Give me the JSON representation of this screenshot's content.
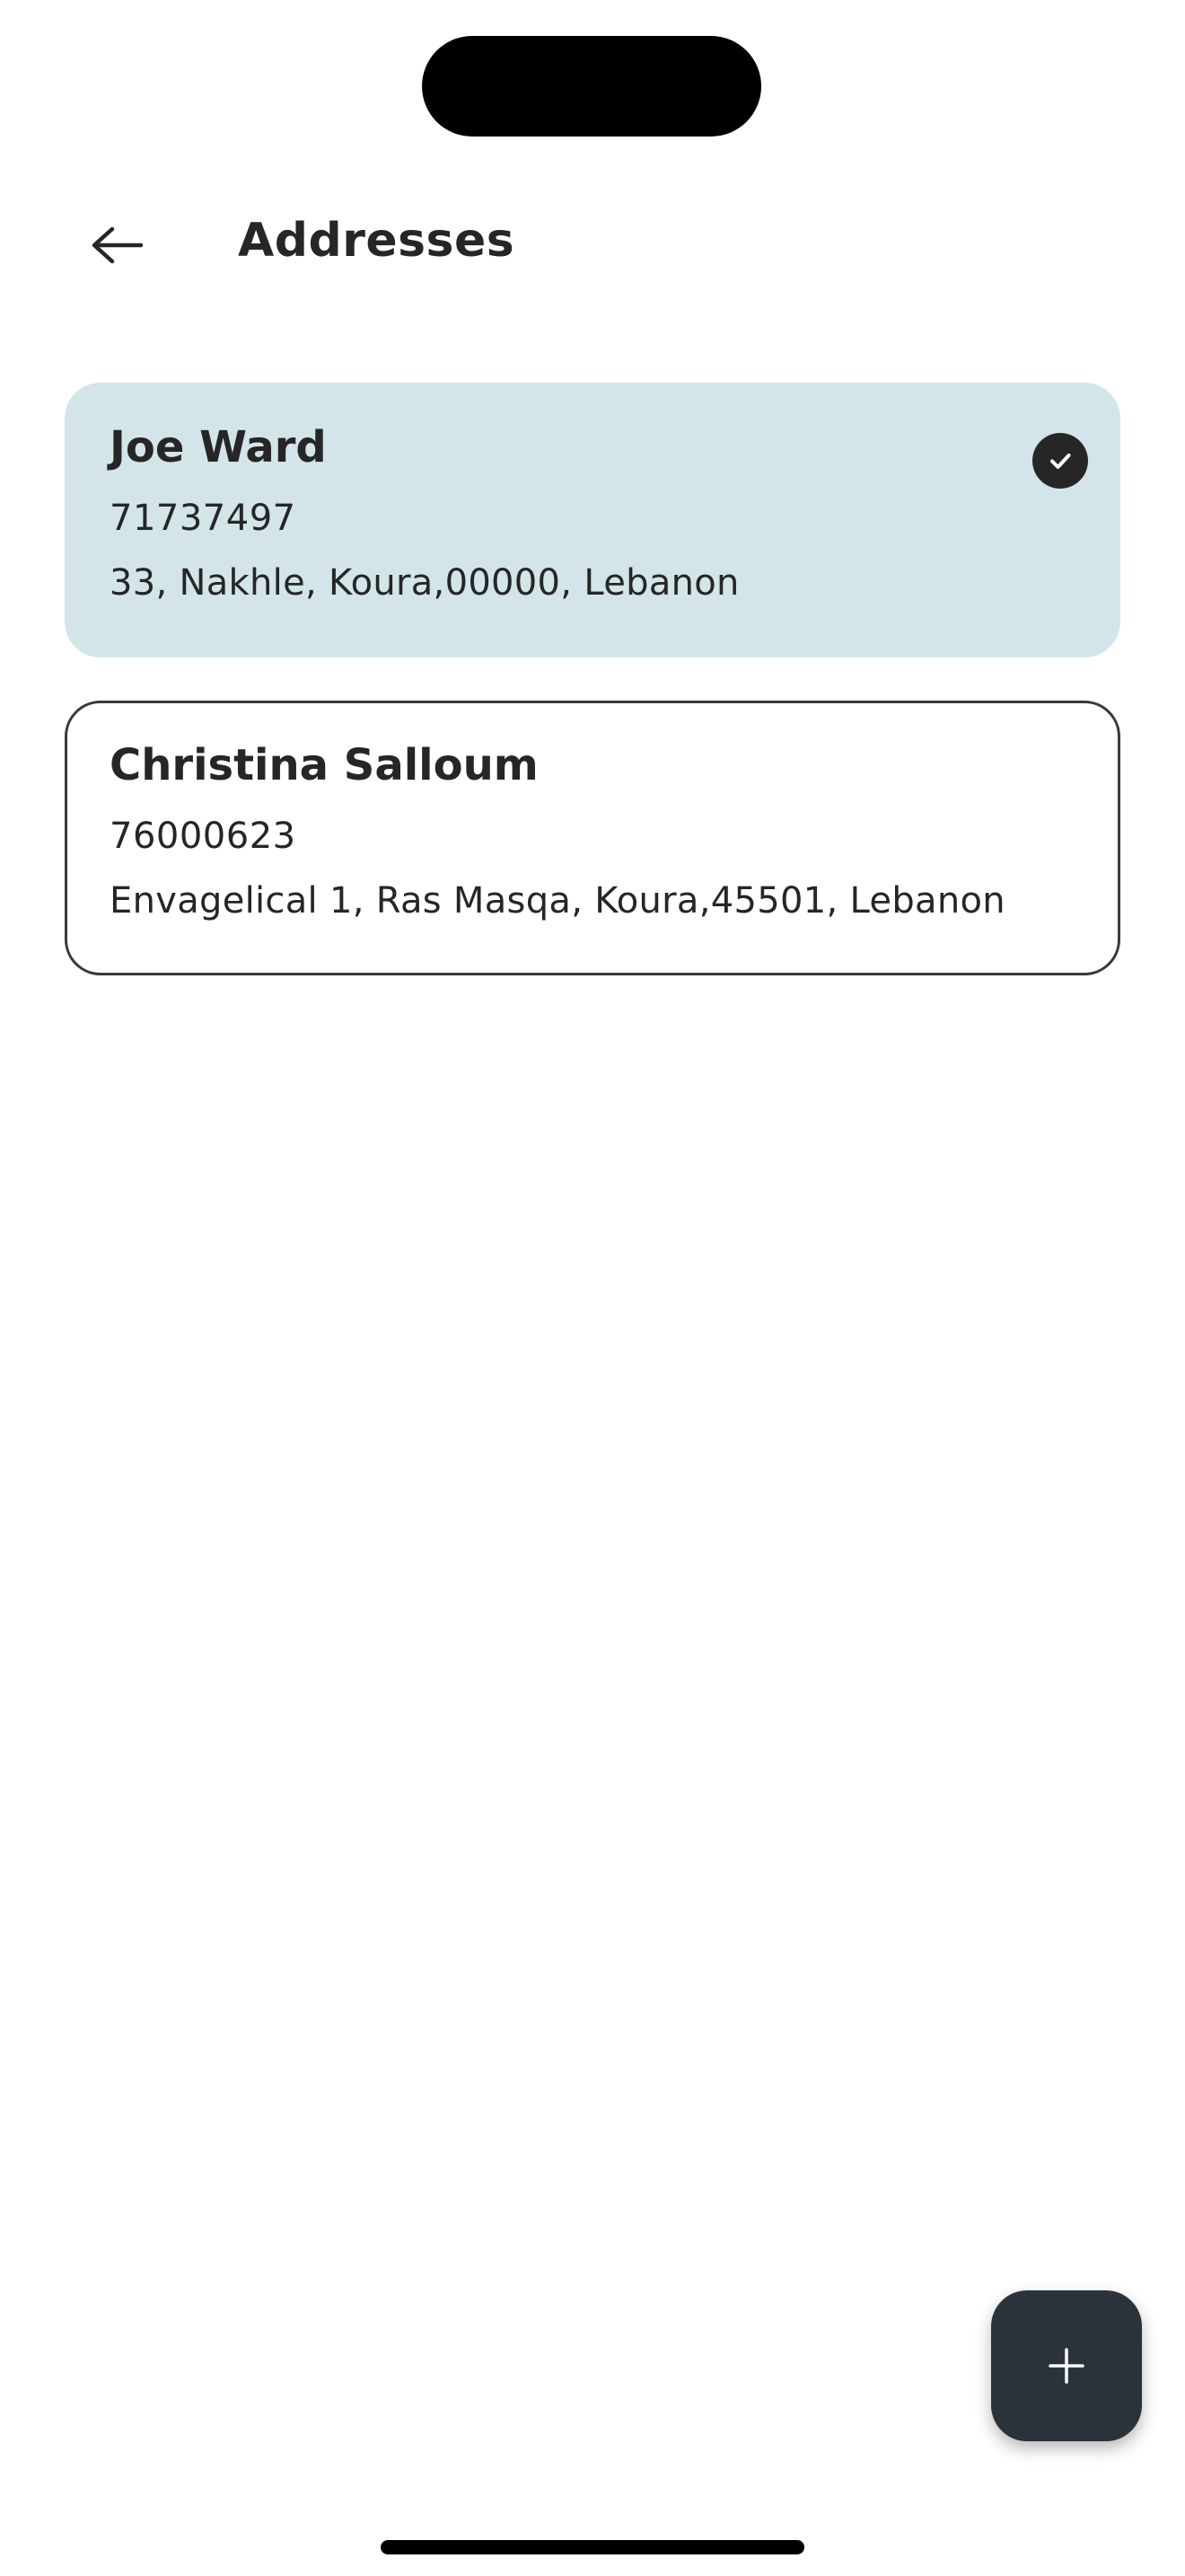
{
  "header": {
    "title": "Addresses",
    "back_icon": "arrow-left-icon"
  },
  "addresses": [
    {
      "name": "Joe Ward",
      "phone": "71737497",
      "address": "33, Nakhle, Koura,00000, Lebanon",
      "selected": true
    },
    {
      "name": "Christina Salloum",
      "phone": "76000623",
      "address": "Envagelical 1, Ras Masqa, Koura,45501, Lebanon",
      "selected": false
    }
  ],
  "fab": {
    "icon": "plus-icon"
  },
  "colors": {
    "selected_card_bg": "#d3e5e9",
    "text": "#262626",
    "fab_bg": "#2b333a"
  }
}
